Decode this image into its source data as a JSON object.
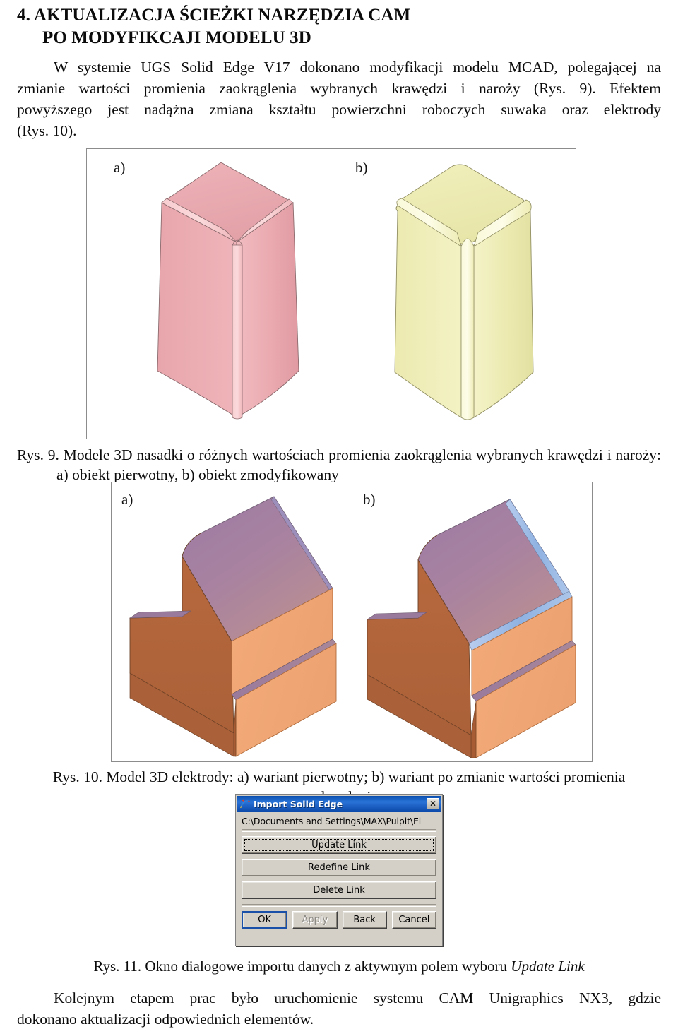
{
  "heading": {
    "line1": "4. AKTUALIZACJA ŚCIEŻKI NARZĘDZIA CAM",
    "line2": "PO MODYFIKCAJI MODELU 3D"
  },
  "intro_paragraph": {
    "line1": "W systemie UGS Solid Edge V17 dokonano modyfikacji modelu MCAD, polegającej na",
    "line2": "zmianie wartości promienia zaokrąglenia wybranych krawędzi i naroży (Rys. 9). Efektem",
    "line3": "powyższego jest nadążna zmiana kształtu powierzchni roboczych suwaka oraz elektrody",
    "line4": "(Rys. 10)."
  },
  "figure9": {
    "label_a": "a)",
    "label_b": "b)",
    "caption_line1": "Rys. 9. Modele 3D nasadki o różnych wartościach promienia zaokrąglenia wybranych krawędzi i naroży:",
    "caption_line2": "a) obiekt pierwotny, b) obiekt zmodyfikowany",
    "color_a": "#e8a8ad",
    "color_b": "#eeedb0"
  },
  "figure10": {
    "label_a": "a)",
    "label_b": "b)",
    "caption": "Rys. 10. Model 3D elektrody: a) wariant pierwotny; b) wariant po zmianie wartości promienia zaokrąglenia",
    "color_front": "#b5673c",
    "color_side": "#f0a978",
    "color_top": "#a1799c",
    "color_highlight": "#8fb4e0"
  },
  "dialog": {
    "icon": "solid-edge-swoosh-icon",
    "title": "Import Solid Edge",
    "close_label": "✕",
    "path": "C:\\Documents and Settings\\MAX\\Pulpit\\El",
    "buttons": {
      "update_link": "Update Link",
      "redefine_link": "Redefine Link",
      "delete_link": "Delete Link"
    },
    "footer": {
      "ok": "OK",
      "apply": "Apply",
      "back": "Back",
      "cancel": "Cancel"
    },
    "accent": "#1b50a8"
  },
  "figure11": {
    "caption_prefix": "Rys. 11. Okno dialogowe importu danych z aktywnym polem wyboru ",
    "caption_emphasis": "Update Link"
  },
  "closing_paragraph": {
    "line1": "Kolejnym etapem prac było uruchomienie systemu CAM Unigraphics NX3, gdzie",
    "line2": "dokonano aktualizacji odpowiednich elementów."
  }
}
